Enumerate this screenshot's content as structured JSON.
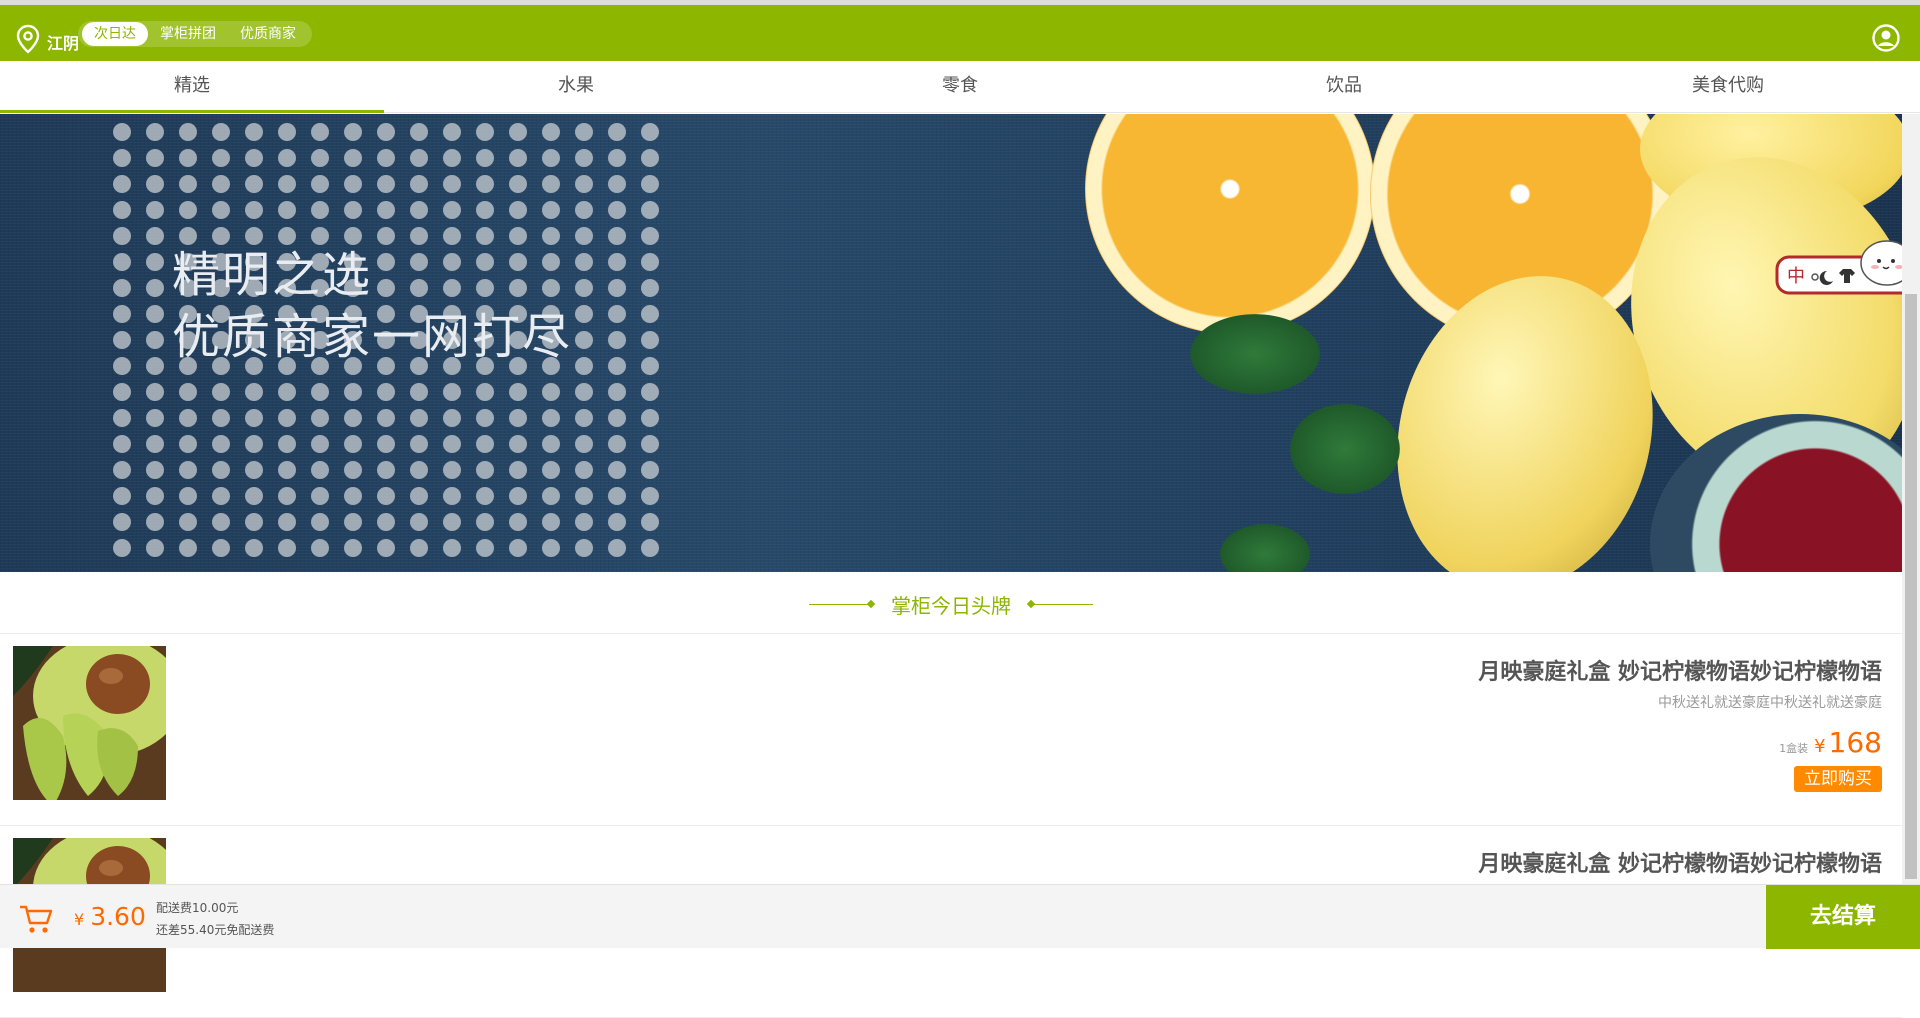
{
  "header": {
    "location_text": "江阴",
    "pills": [
      {
        "label": "次日达",
        "active": true
      },
      {
        "label": "掌柜拼团",
        "active": false
      },
      {
        "label": "优质商家",
        "active": false
      }
    ],
    "icons": {
      "location": "location-pin-icon",
      "user": "user-circle-icon"
    },
    "brand_color": "#8db600"
  },
  "tabs": [
    {
      "label": "精选",
      "active": true
    },
    {
      "label": "水果",
      "active": false
    },
    {
      "label": "零食",
      "active": false
    },
    {
      "label": "饮品",
      "active": false
    },
    {
      "label": "美食代购",
      "active": false
    }
  ],
  "banner": {
    "line1": "精明之选",
    "line2": "优质商家一网打尽"
  },
  "mascot": {
    "icons": [
      "mascot-icon"
    ]
  },
  "section": {
    "title": "掌柜今日头牌"
  },
  "products": [
    {
      "name": "月映豪庭礼盒 妙记柠檬物语妙记柠檬物语",
      "subtitle": "中秋送礼就送豪庭中秋送礼就送豪庭",
      "unit": "1盒装",
      "currency": "¥",
      "price": "168",
      "buy_label": "立即购买"
    },
    {
      "name": "月映豪庭礼盒 妙记柠檬物语妙记柠檬物语",
      "subtitle": "",
      "unit": "",
      "currency": "",
      "price": "",
      "buy_label": ""
    }
  ],
  "cart": {
    "currency": "¥",
    "total": "3.60",
    "delivery_fee": "配送费10.00元",
    "free_delivery_gap": "还差55.40元免配送费",
    "checkout_label": "去结算",
    "accent_color": "#ff6a00"
  }
}
